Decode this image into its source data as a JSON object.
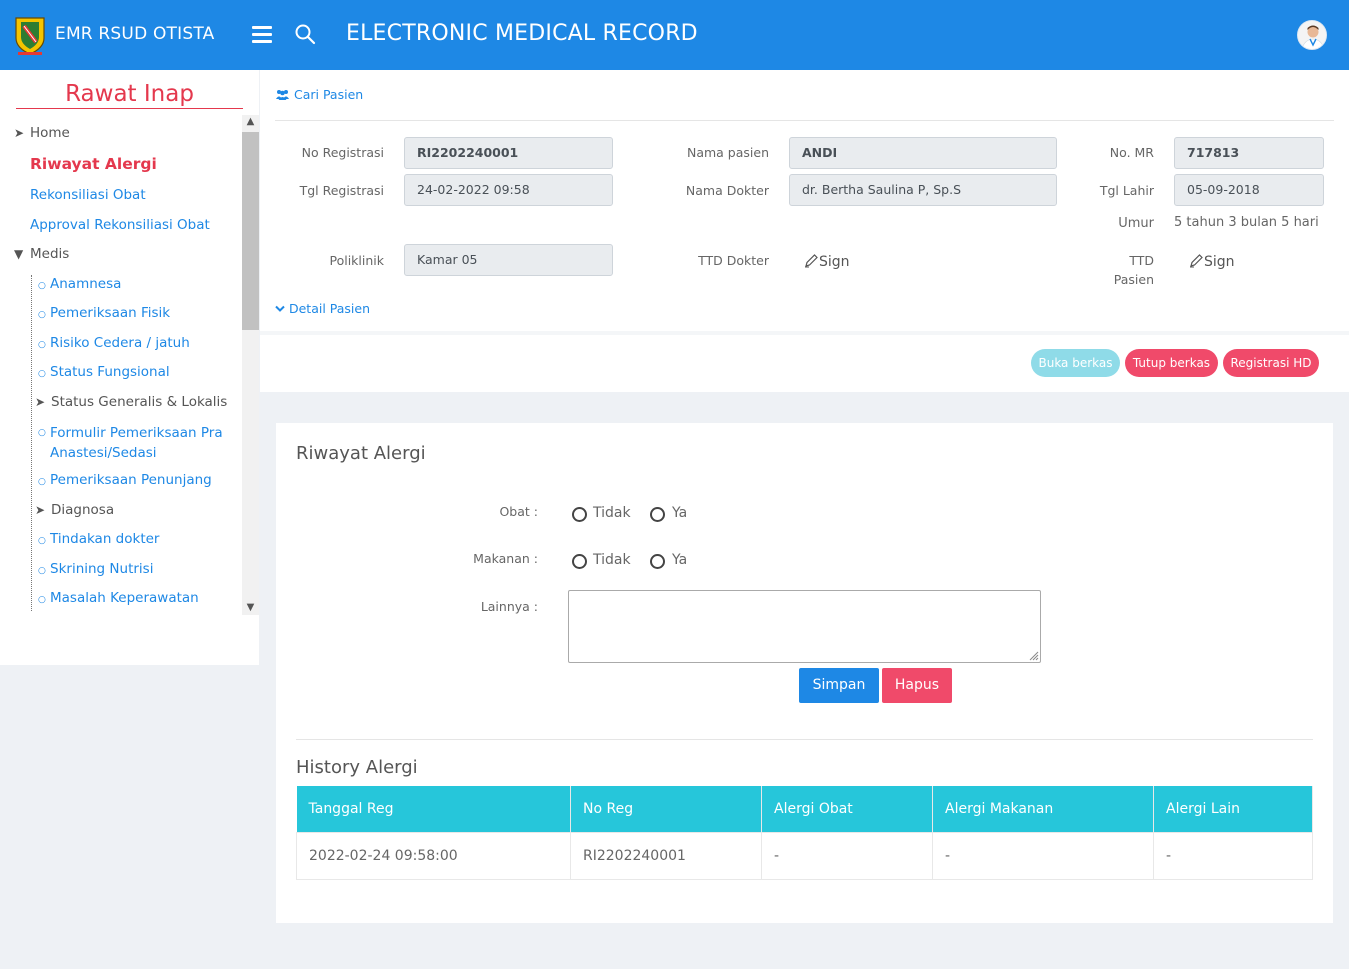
{
  "header": {
    "app_name": "EMR RSUD OTISTA",
    "page_title": "ELECTRONIC MEDICAL RECORD"
  },
  "sidebar": {
    "title": "Rawat Inap",
    "items": [
      {
        "label": "Home",
        "kind": "arrow-dark"
      },
      {
        "label": "Riwayat Alergi",
        "kind": "active"
      },
      {
        "label": "Rekonsiliasi Obat",
        "kind": "link"
      },
      {
        "label": "Approval Rekonsiliasi Obat",
        "kind": "link"
      },
      {
        "label": "Medis",
        "kind": "expanded-dark"
      },
      {
        "label": "Anamnesa",
        "kind": "sub-link"
      },
      {
        "label": "Pemeriksaan Fisik",
        "kind": "sub-link"
      },
      {
        "label": "Risiko Cedera / jatuh",
        "kind": "sub-link"
      },
      {
        "label": "Status Fungsional",
        "kind": "sub-link"
      },
      {
        "label": "Status Generalis & Lokalis",
        "kind": "sub-arrow-dark"
      },
      {
        "label": "Formulir Pemeriksaan Pra Anastesi/Sedasi",
        "kind": "sub-link"
      },
      {
        "label": "Pemeriksaan Penunjang",
        "kind": "sub-link"
      },
      {
        "label": "Diagnosa",
        "kind": "sub-arrow-dark"
      },
      {
        "label": "Tindakan dokter",
        "kind": "sub-link"
      },
      {
        "label": "Skrining Nutrisi",
        "kind": "sub-link"
      },
      {
        "label": "Masalah Keperawatan",
        "kind": "sub-link"
      }
    ]
  },
  "patient": {
    "cari_pasien": "Cari Pasien",
    "no_registrasi_label": "No Registrasi",
    "no_registrasi": "RI2202240001",
    "tgl_registrasi_label": "Tgl Registrasi",
    "tgl_registrasi": "24-02-2022 09:58",
    "poliklinik_label": "Poliklinik",
    "poliklinik": "Kamar 05",
    "nama_pasien_label": "Nama pasien",
    "nama_pasien": "ANDI",
    "nama_dokter_label": "Nama Dokter",
    "nama_dokter": "dr. Bertha Saulina P, Sp.S",
    "ttd_dokter_label": "TTD Dokter",
    "no_mr_label": "No. MR",
    "no_mr": "717813",
    "tgl_lahir_label": "Tgl Lahir",
    "tgl_lahir": "05-09-2018",
    "umur_label": "Umur",
    "umur": "5 tahun 3 bulan 5 hari",
    "ttd_pasien_label_1": "TTD",
    "ttd_pasien_label_2": "Pasien",
    "sign_label": "Sign",
    "detail_pasien": "Detail Pasien"
  },
  "actions": {
    "buka": "Buka berkas",
    "tutup": "Tutup berkas",
    "registrasi_hd": "Registrasi HD"
  },
  "form": {
    "title": "Riwayat Alergi",
    "obat_label": "Obat :",
    "makanan_label": "Makanan :",
    "lainnya_label": "Lainnya :",
    "tidak": "Tidak",
    "ya": "Ya",
    "simpan": "Simpan",
    "hapus": "Hapus"
  },
  "history": {
    "title": "History Alergi",
    "columns": [
      "Tanggal Reg",
      "No Reg",
      "Alergi Obat",
      "Alergi Makanan",
      "Alergi Lain"
    ],
    "rows": [
      [
        "2022-02-24 09:58:00",
        "RI2202240001",
        "-",
        "-",
        "-"
      ]
    ]
  },
  "colors": {
    "primary": "#1e88e5",
    "danger": "#f04a6a",
    "info": "#26c6da",
    "sidebar_title": "#e4384d"
  }
}
